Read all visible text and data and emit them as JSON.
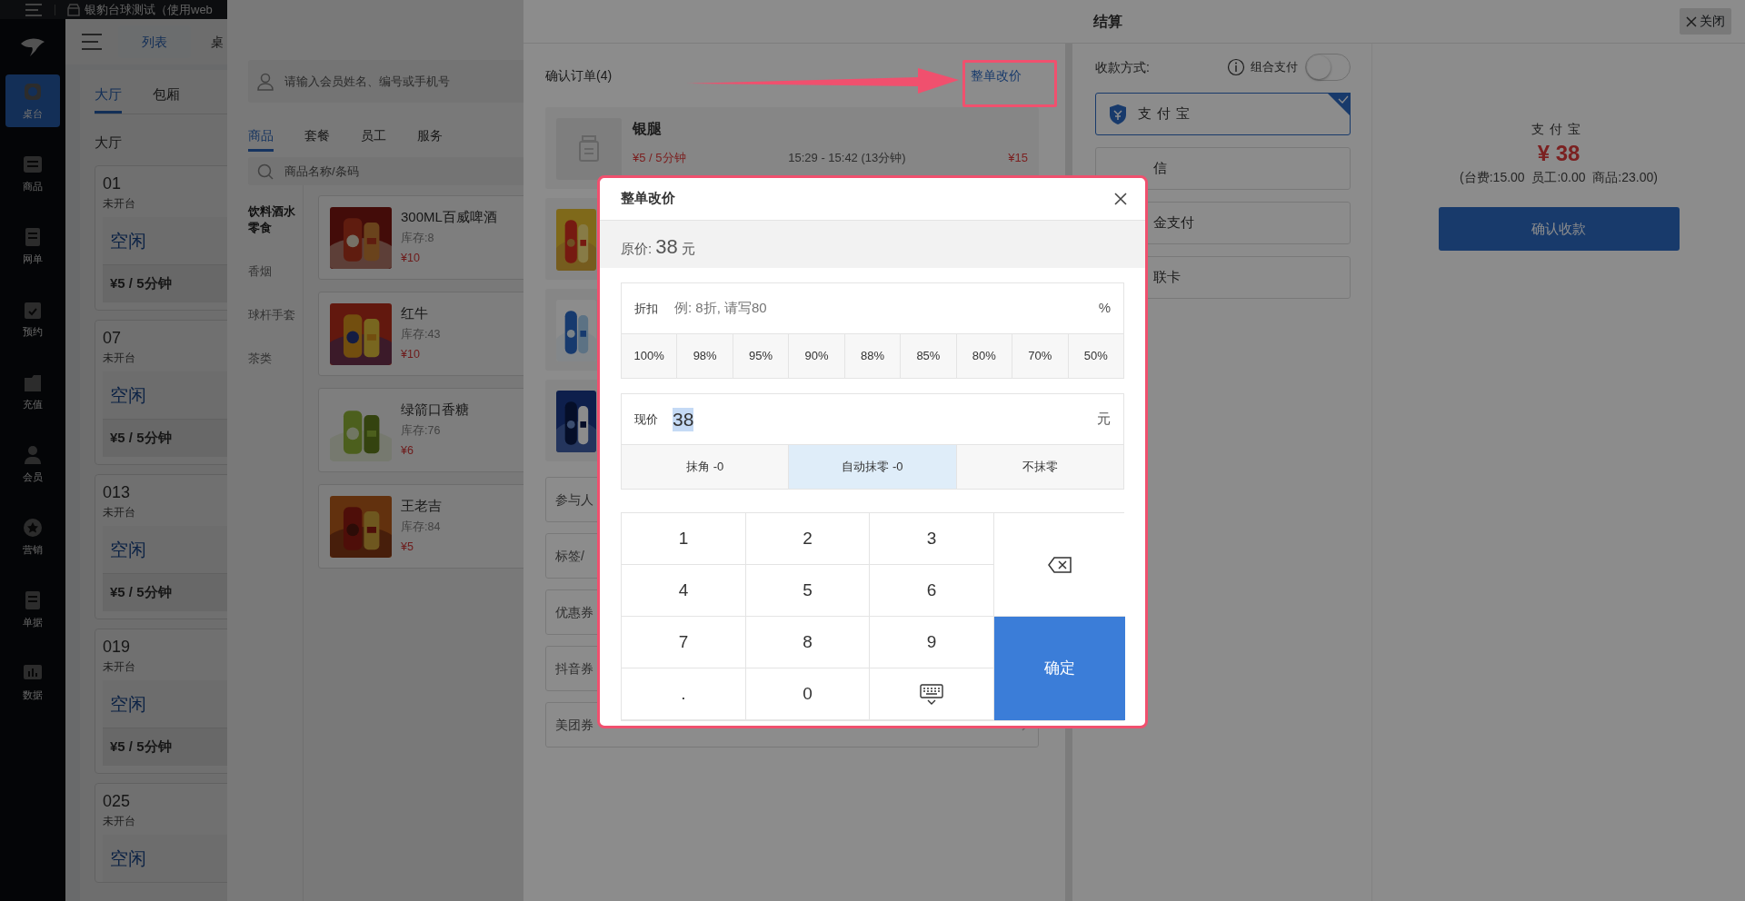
{
  "top_bar": {
    "title": "银豹台球测试（使用web"
  },
  "sidebar": {
    "items": [
      {
        "label": "桌台",
        "selected": true
      },
      {
        "label": "商品",
        "selected": false
      },
      {
        "label": "网单",
        "selected": false
      },
      {
        "label": "预约",
        "selected": false
      },
      {
        "label": "充值",
        "selected": false
      },
      {
        "label": "会员",
        "selected": false
      },
      {
        "label": "营销",
        "selected": false
      },
      {
        "label": "单据",
        "selected": false
      },
      {
        "label": "数据",
        "selected": false
      }
    ]
  },
  "view_tabs": [
    {
      "label": "列表",
      "selected": true
    },
    {
      "label": "桌",
      "selected": false
    }
  ],
  "area_tabs": [
    {
      "label": "大厅",
      "selected": true
    },
    {
      "label": "包厢",
      "selected": false
    }
  ],
  "section_title": "大厅",
  "tables": [
    {
      "number": "01",
      "state": "未开台",
      "status": "空闲",
      "rate": "¥5 / 5分钟"
    },
    {
      "number": "07",
      "state": "未开台",
      "status": "空闲",
      "rate": "¥5 / 5分钟"
    },
    {
      "number": "013",
      "state": "未开台",
      "status": "空闲",
      "rate": "¥5 / 5分钟"
    },
    {
      "number": "019",
      "state": "未开台",
      "status": "空闲",
      "rate": "¥5 / 5分钟"
    },
    {
      "number": "025",
      "state": "未开台",
      "status": "空闲"
    }
  ],
  "product_panel": {
    "member_search": {
      "placeholder": "请输入会员姓名、编号或手机号"
    },
    "tabs": [
      {
        "label": "商品",
        "selected": true
      },
      {
        "label": "套餐",
        "selected": false
      },
      {
        "label": "员工",
        "selected": false
      },
      {
        "label": "服务",
        "selected": false
      }
    ],
    "product_search": {
      "placeholder": "商品名称/条码"
    },
    "categories": [
      {
        "label": "饮料酒水零食",
        "selected": true
      },
      {
        "label": "香烟",
        "selected": false
      },
      {
        "label": "球杆手套",
        "selected": false
      },
      {
        "label": "茶类",
        "selected": false
      }
    ],
    "products": [
      {
        "name": "300ML百威啤酒",
        "stock": "库存:8",
        "price": "¥10"
      },
      {
        "name": "红牛",
        "stock": "库存:43",
        "price": "¥10"
      },
      {
        "name": "绿箭口香糖",
        "stock": "库存:76",
        "price": "¥6"
      },
      {
        "name": "王老吉",
        "stock": "库存:84",
        "price": "¥5"
      }
    ]
  },
  "checkout": {
    "title": "结算",
    "close": "关闭",
    "order_title": "确认订单(4)",
    "reprice_link": "整单改价",
    "order_items": [
      {
        "kind": "placeholder",
        "name": "银腿",
        "rate": "¥5 / 5分钟",
        "time": "15:29 - 15:42 (13分钟)",
        "amount": "¥15"
      },
      {
        "kind": "picture"
      },
      {
        "kind": "picture"
      },
      {
        "kind": "picture"
      }
    ],
    "extra_rows": [
      {
        "label": "参与人"
      },
      {
        "label": "标签/"
      },
      {
        "label": "优惠券"
      },
      {
        "label": "抖音券"
      },
      {
        "label": "美团券",
        "kind": "select"
      }
    ],
    "payment": {
      "label": "收款方式:",
      "combo_label": "组合支付",
      "combo_on": false,
      "methods": [
        {
          "label": "支付宝",
          "selected": true
        },
        {
          "label": "信",
          "selected": false
        },
        {
          "label": "金支付",
          "selected": false
        },
        {
          "label": "联卡",
          "selected": false
        }
      ]
    },
    "summary": {
      "method": "支付宝",
      "amount": "¥ 38",
      "breakdown": "(台费:15.00  员工:0.00  商品:23.00)",
      "confirm": "确认收款"
    }
  },
  "dialog": {
    "title": "整单改价",
    "original_label": "原价:",
    "original_value": "38",
    "original_unit": "元",
    "discount": {
      "label": "折扣",
      "placeholder": "例: 8折, 请写80",
      "unit": "%",
      "presets": [
        "100%",
        "98%",
        "95%",
        "90%",
        "88%",
        "85%",
        "80%",
        "70%",
        "50%"
      ]
    },
    "current": {
      "label": "现价",
      "value": "38",
      "unit": "元"
    },
    "rounding": [
      {
        "label": "抹角 -0",
        "selected": false
      },
      {
        "label": "自动抹零 -0",
        "selected": true
      },
      {
        "label": "不抹零",
        "selected": false
      }
    ],
    "keys": [
      {
        "kind": "digit",
        "label": "1"
      },
      {
        "kind": "digit",
        "label": "2"
      },
      {
        "kind": "digit",
        "label": "3"
      },
      {
        "kind": "digit",
        "label": "4"
      },
      {
        "kind": "digit",
        "label": "5"
      },
      {
        "kind": "digit",
        "label": "6"
      },
      {
        "kind": "digit",
        "label": "7"
      },
      {
        "kind": "digit",
        "label": "8"
      },
      {
        "kind": "digit",
        "label": "9"
      },
      {
        "kind": "digit",
        "label": "."
      },
      {
        "kind": "digit",
        "label": "0"
      },
      {
        "kind": "keyboard"
      }
    ],
    "confirm": "确定"
  }
}
